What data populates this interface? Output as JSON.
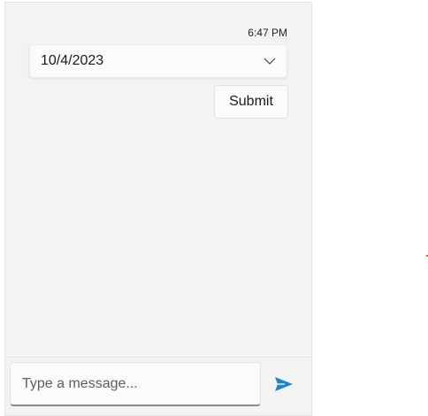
{
  "chat": {
    "timestamp": "6:47 PM",
    "date_input": {
      "value": "10/4/2023",
      "icon": "chevron-down-icon"
    },
    "submit_label": "Submit"
  },
  "composer": {
    "placeholder": "Type a message...",
    "send_icon": "send-icon"
  },
  "colors": {
    "panel_background": "#f3f3f3",
    "send_accent": "#1d84c6",
    "input_underline": "#8a8a8a"
  }
}
